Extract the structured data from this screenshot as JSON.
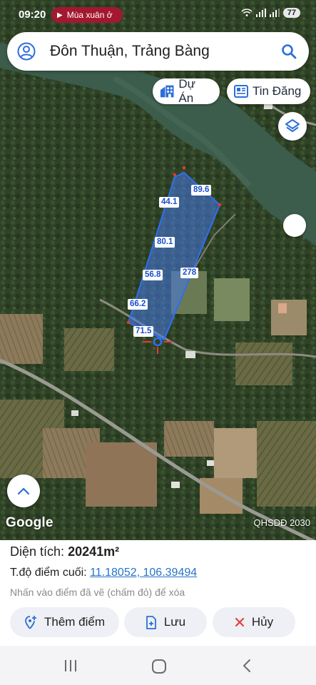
{
  "status_bar": {
    "time": "09:20",
    "notification_chip": "Mùa xuân ở",
    "battery": "77"
  },
  "search": {
    "query": "Đôn Thuận, Trảng Bàng"
  },
  "map_chips": {
    "projects": "Dự Án",
    "listings": "Tin Đăng"
  },
  "parcel": {
    "segments": [
      "89.6",
      "44.1",
      "80.1",
      "56.8",
      "278",
      "66.2",
      "71.5"
    ]
  },
  "map_footer": {
    "logo": "Google",
    "plan_label": "QHSDĐ 2030"
  },
  "panel": {
    "area_label": "Diện tích:",
    "area_value": "20241m²",
    "coord_label": "T.độ điểm cuối:",
    "coord_value": "11.18052, 106.39494",
    "hint": "Nhấn vào điểm đã vẽ (chấm đỏ) để xóa"
  },
  "actions": {
    "add_point": "Thêm điểm",
    "save": "Lưu",
    "cancel": "Hủy"
  },
  "colors": {
    "accent": "#2672c9",
    "parcel_stroke": "#2f6ff0",
    "cancel_icon": "#e53935"
  },
  "icons": {
    "avatar": "account-circle-icon",
    "search": "search-icon",
    "projects": "building-icon",
    "listings": "newspaper-icon",
    "layers": "layers-icon",
    "up": "chevron-up-icon",
    "add_point": "add-location-icon",
    "save": "file-plus-icon",
    "cancel": "close-icon"
  }
}
